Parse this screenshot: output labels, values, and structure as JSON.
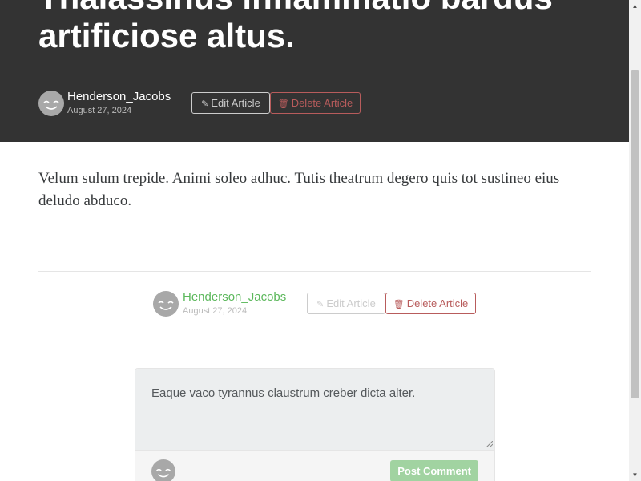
{
  "article": {
    "title": "Thalassinus inflammatio bardus artificiose altus.",
    "author": "Henderson_Jacobs",
    "date": "August 27, 2024",
    "body": "Velum sulum trepide. Animi soleo adhuc. Tutis theatrum degero quis tot sustineo eius deludo abduco."
  },
  "actions": {
    "edit_label": "Edit Article",
    "delete_label": "Delete Article",
    "edit_icon": "pencil-icon",
    "delete_icon": "trash-icon"
  },
  "comment_form": {
    "value": "Eaque vaco tyrannus claustrum creber dicta alter.",
    "submit_label": "Post Comment"
  },
  "colors": {
    "banner": "#333333",
    "accent": "#5cb85c",
    "danger": "#b85c5c"
  }
}
